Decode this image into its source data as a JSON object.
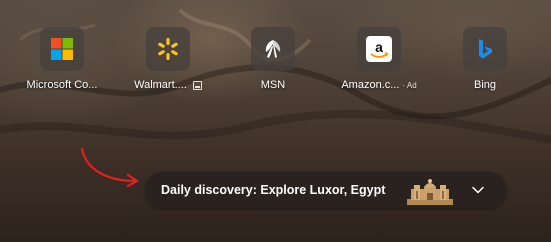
{
  "tiles": [
    {
      "label": "Microsoft Co...",
      "icon": "microsoft-logo-icon",
      "ad": "",
      "pinned": false
    },
    {
      "label": "Walmart....",
      "icon": "walmart-spark-icon",
      "ad": "",
      "pinned": true
    },
    {
      "label": "MSN",
      "icon": "msn-butterfly-icon",
      "ad": "",
      "pinned": false
    },
    {
      "label": "Amazon.c...",
      "icon": "amazon-logo-icon",
      "ad": "· Ad",
      "pinned": false
    },
    {
      "label": "Bing",
      "icon": "bing-logo-icon",
      "ad": "",
      "pinned": false
    }
  ],
  "discovery": {
    "text": "Daily discovery: Explore Luxor, Egypt",
    "thumbnail": "luxor-temple-thumbnail",
    "expand_icon": "chevron-down-icon"
  },
  "annotation": {
    "icon": "red-arrow-icon",
    "color": "#e0201e"
  },
  "colors": {
    "tile_bg": "#46403c",
    "pill_bg": "#282220",
    "text": "#ffffff",
    "microsoft_red": "#f25022",
    "microsoft_green": "#7fba00",
    "microsoft_blue": "#00a4ef",
    "microsoft_yellow": "#ffb900",
    "walmart_yellow": "#ffc220",
    "bing_blue": "#1e8be6"
  }
}
